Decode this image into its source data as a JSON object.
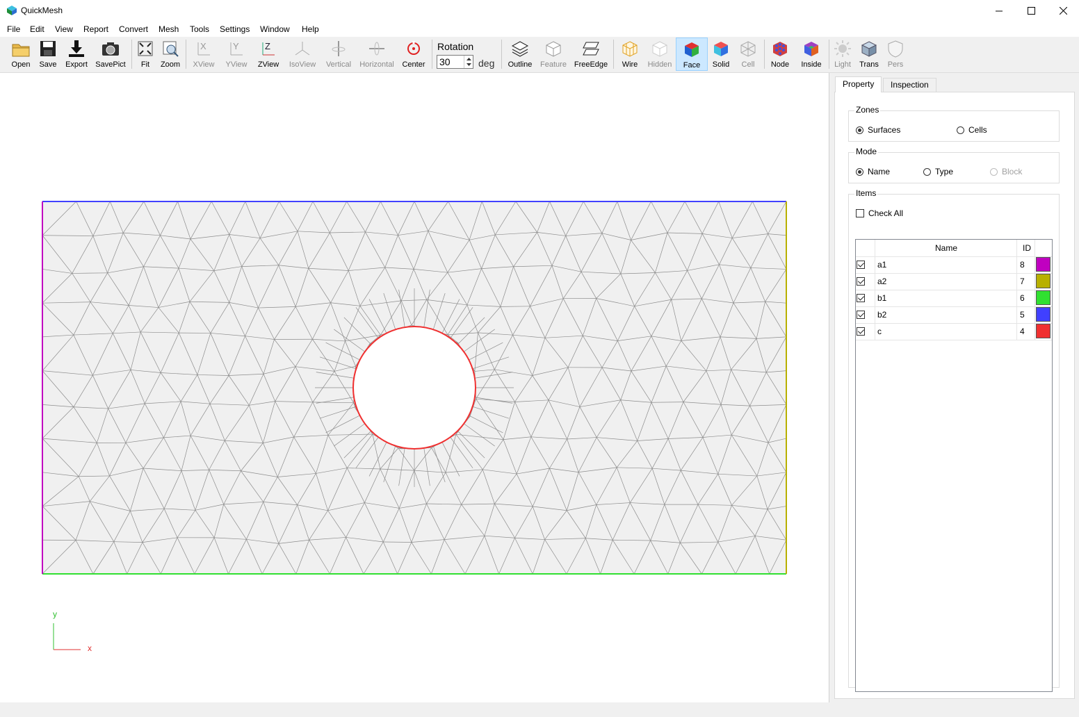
{
  "window": {
    "title": "QuickMesh",
    "minimize": "—",
    "maximize": "☐",
    "close": "✕"
  },
  "menu": [
    "File",
    "Edit",
    "View",
    "Report",
    "Convert",
    "Mesh",
    "Tools",
    "Settings",
    "Window",
    "Help"
  ],
  "toolbar": {
    "open": "Open",
    "save": "Save",
    "export": "Export",
    "savepict": "SavePict",
    "fit": "Fit",
    "zoom": "Zoom",
    "xview": "XView",
    "yview": "YView",
    "zview": "ZView",
    "isoview": "IsoView",
    "vertical": "Vertical",
    "horizontal": "Horizontal",
    "center": "Center",
    "rotation_label": "Rotation",
    "rotation_value": "30",
    "rotation_unit": "deg",
    "outline": "Outline",
    "feature": "Feature",
    "freeedge": "FreeEdge",
    "wire": "Wire",
    "hidden": "Hidden",
    "face": "Face",
    "solid": "Solid",
    "cell": "Cell",
    "node": "Node",
    "inside": "Inside",
    "light": "Light",
    "trans": "Trans",
    "pers": "Pers"
  },
  "viewport": {
    "axis_y": "y",
    "axis_x": "x"
  },
  "panel": {
    "tabs": [
      "Property",
      "Inspection"
    ],
    "zones": {
      "title": "Zones",
      "options": [
        "Surfaces",
        "Cells"
      ],
      "selected": "Surfaces"
    },
    "mode": {
      "title": "Mode",
      "options": [
        "Name",
        "Type",
        "Block"
      ],
      "selected": "Name"
    },
    "items": {
      "title": "Items",
      "check_all": "Check All",
      "headers": {
        "name": "Name",
        "id": "ID"
      },
      "rows": [
        {
          "name": "a1",
          "id": "8",
          "color": "#c000c0",
          "checked": true
        },
        {
          "name": "a2",
          "id": "7",
          "color": "#b8b000",
          "checked": true
        },
        {
          "name": "b1",
          "id": "6",
          "color": "#30e030",
          "checked": true
        },
        {
          "name": "b2",
          "id": "5",
          "color": "#4040ff",
          "checked": true
        },
        {
          "name": "c",
          "id": "4",
          "color": "#f03030",
          "checked": true
        }
      ]
    }
  },
  "colors": {
    "mesh_fill": "#f0f0f0",
    "mesh_line": "#8c8c8c",
    "boundary_left": "#c000c0",
    "boundary_right": "#b8b000",
    "boundary_bottom": "#30e030",
    "boundary_top": "#4040ff",
    "hole": "#f03030"
  }
}
